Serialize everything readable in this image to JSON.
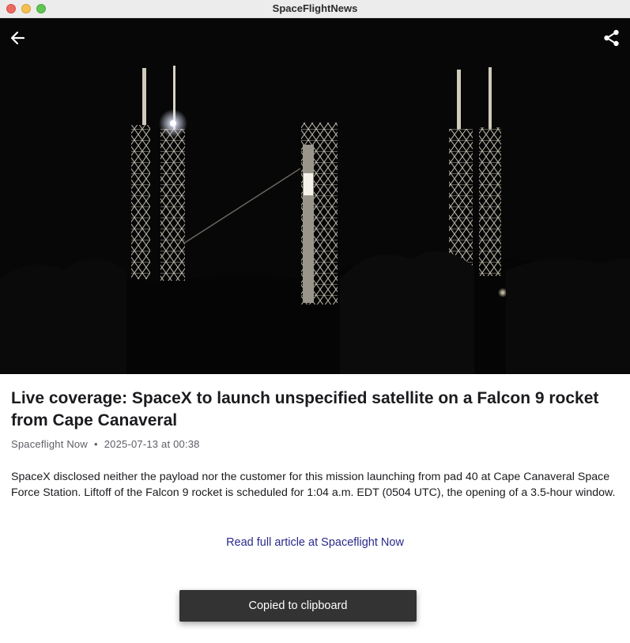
{
  "window": {
    "title": "SpaceFlightNews"
  },
  "toolbar": {
    "back_icon": "arrow-left-icon",
    "share_icon": "share-icon"
  },
  "article": {
    "title": "Live coverage: SpaceX to launch unspecified satellite on a Falcon 9 rocket from Cape Canaveral",
    "source": "Spaceflight Now",
    "separator": "•",
    "date": "2025-07-13 at 00:38",
    "summary": "SpaceX disclosed neither the payload nor the customer for this mission launching from pad 40 at Cape Canaveral Space Force Station. Liftoff of the Falcon 9 rocket is scheduled for 1:04 a.m. EDT (0504 UTC), the opening of a 3.5-hour window.",
    "link_label": "Read full article at Spaceflight Now"
  },
  "toast": {
    "message": "Copied to clipboard"
  },
  "colors": {
    "link": "#2a2a8c",
    "toast_bg": "#333333",
    "hero_bg": "#070708"
  }
}
